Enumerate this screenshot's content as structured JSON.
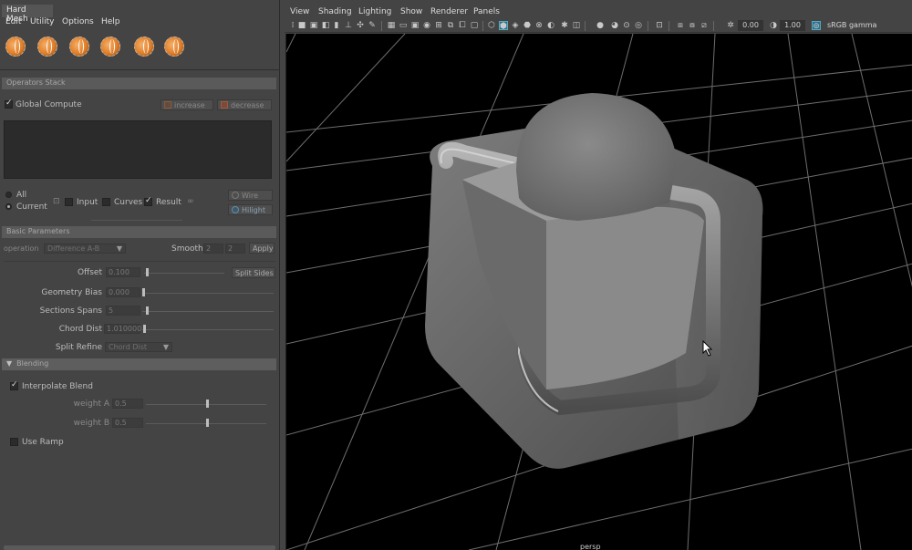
{
  "panel": {
    "title": "Hard Mesh",
    "menu": [
      "Edit",
      "Utility",
      "Options",
      "Help"
    ],
    "shelf_icons": [
      "sphere-tool-icon-1",
      "sphere-tool-icon-2",
      "sphere-tool-icon-3",
      "sphere-tool-icon-4",
      "sphere-tool-icon-5",
      "sphere-tool-icon-6"
    ]
  },
  "operators": {
    "header": "Operators Stack",
    "global_compute": "Global Compute",
    "increase": "increase",
    "decrease": "decrease",
    "radio_all": "All",
    "radio_current": "Current",
    "input": "Input",
    "curves": "Curves",
    "result": "Result",
    "wire": "Wire",
    "hilight": "Hilight"
  },
  "basic": {
    "header": "Basic Parameters",
    "operation_label": "operation",
    "operation_value": "Difference A-B",
    "smooth_label": "Smooth",
    "smooth_a": "2",
    "smooth_b": "2",
    "apply": "Apply",
    "offset_label": "Offset",
    "offset_value": "0.100",
    "split_sides": "Split Sides",
    "geom_bias_label": "Geometry Bias",
    "geom_bias_value": "0.000",
    "sections_label": "Sections Spans",
    "sections_value": "5",
    "chord_label": "Chord Dist",
    "chord_value": "1.010000",
    "split_refine_label": "Split Refine",
    "split_refine_value": "Chord Dist"
  },
  "blending": {
    "header": "Blending",
    "interpolate": "Interpolate Blend",
    "weight_a_label": "weight A",
    "weight_a_value": "0.5",
    "weight_b_label": "weight B",
    "weight_b_value": "0.5",
    "use_ramp": "Use Ramp"
  },
  "viewport": {
    "menu": [
      "View",
      "Shading",
      "Lighting",
      "Show",
      "Renderer",
      "Panels"
    ],
    "exposure": "0.00",
    "gamma": "1.00",
    "color_space": "sRGB gamma",
    "camera": "persp"
  },
  "colors": {
    "accent": "#e07f2a",
    "highlight_blue": "#2c6f8f",
    "viewport_bg": "#000000"
  }
}
